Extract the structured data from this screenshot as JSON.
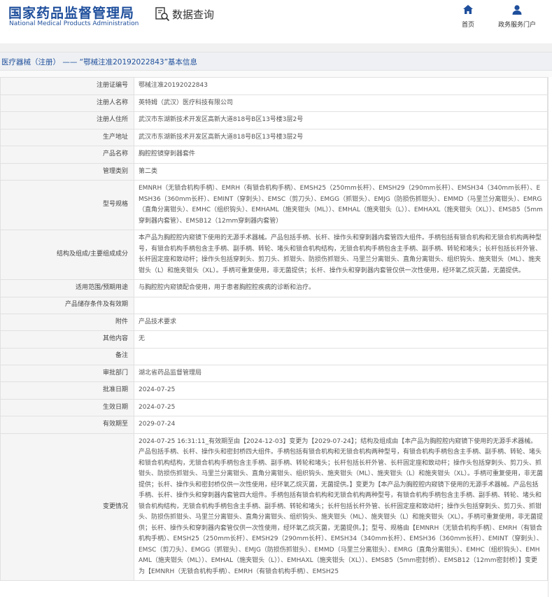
{
  "header": {
    "logo_cn": "国家药品监督管理局",
    "logo_en": "National Medical Products Administration",
    "data_query": "数据查询",
    "nav": {
      "home": "首页",
      "gov_service": "政务服务门户"
    }
  },
  "page_title": "医疗器械（注册） —— “鄂械注准20192022843”基本信息",
  "rows": [
    {
      "key": "注册证编号",
      "value": "鄂械注准20192022843"
    },
    {
      "key": "注册人名称",
      "value": "英特姆（武汉）医疗科技有限公司"
    },
    {
      "key": "注册人住所",
      "value": "武汉市东湖新技术开发区高新大道818号B区13号楼3层2号"
    },
    {
      "key": "生产地址",
      "value": "武汉市东湖新技术开发区高新大道818号B区13号楼3层2号"
    },
    {
      "key": "产品名称",
      "value": "胸腔腔镜穿刺器套件"
    },
    {
      "key": "管理类别",
      "value": "第二类"
    },
    {
      "key": "型号规格",
      "value": "EMNRH（无锁合机构手柄）、EMRH（有锁合机构手柄）、EMSH25（250mm长杆）、EMSH29（290mm长杆）、EMSH34（340mm长杆）、EMSH36（360mm长杆）、EMINT（穿刺头）、EMSC（剪刀头）、EMGG（抓钳头）、EMJG（防损伤抓钳头）、EMMD（马里兰分离钳头）、EMRG（直角分离钳头）、EMHC（组织钩头）、EMHAML（施夹钳头（ML））、EMHAL（施夹钳头（L））、EMHAXL（施夹钳头（XL））、EMSB5（5mm穿刺器内套管）、EMSB12（12mm穿刺器内套管）"
    },
    {
      "key": "结构及组成/主要组成成分",
      "value": "本产品为胸腔腔内窥镜下使用的无源手术器械。产品包括手柄、长杆、操作头和穿刺器内套管四大组件。手柄包括有锁合机构和无锁合机构两种型号，有锁合机构手柄包含主手柄、副手柄、转轮、堵头和锁合机构结构，无锁合机构手柄包含主手柄、副手柄、转轮和堵头；长杆包括长杆外管、长杆固定座和致动杆；操作头包括穿刺头、剪刀头、抓钳头、防损伤抓钳头、马里兰分离钳头、直角分离钳头、组织钩头、施夹钳头（ML）、施夹钳头（L）和施夹钳头（XL）。手柄可重复使用，非无菌提供；长杆、操作头和穿刺器内套管仅供一次性使用，经环氧乙烷灭菌，无菌提供。"
    },
    {
      "key": "适用范围/预期用途",
      "value": "与胸腔腔内窥镜配合使用，用于患者胸腔腔疾病的诊断和治疗。"
    },
    {
      "key": "产品储存条件及有效期",
      "value": ""
    },
    {
      "key": "附件",
      "value": "产品技术要求"
    },
    {
      "key": "其他内容",
      "value": "无"
    },
    {
      "key": "备注",
      "value": ""
    },
    {
      "key": "审批部门",
      "value": "湖北省药品监督管理局"
    },
    {
      "key": "批准日期",
      "value": "2024-07-25"
    },
    {
      "key": "生效日期",
      "value": "2024-07-25"
    },
    {
      "key": "有效期至",
      "value": "2029-07-24"
    },
    {
      "key": "变更情况",
      "value": "2024-07-25 16:31:11_有效期至由【2024-12-03】变更为【2029-07-24】；结构及组成由【本产品为胸腔腔内窥镜下使用的无源手术器械。产品包括手柄、长杆、操作头和密封桥四大组件。手柄包括有锁合机构和无锁合机构两种型号，有锁合机构手柄包含主手柄、副手柄、转轮、堵头和锁合机构结构，无锁合机构手柄包含主手柄、副手柄、转轮和堵头；长杆包括长杆外管、长杆固定座和致动杆；操作头包括穿刺头、剪刀头、抓钳头、防损伤抓钳头、马里兰分离钳头、直角分离钳头、组织钩头、施夹钳头（ML）、施夹钳头（L）和施夹钳头（XL）。手柄可重复使用，非无菌提供；长杆、操作头和密封桥仅供一次性使用，经环氧乙烷灭菌，无菌提供。】变更为【本产品为胸腔腔内窥镜下使用的无源手术器械。产品包括手柄、长杆、操作头和穿刺器内套管四大组件。手柄包括有锁合机构和无锁合机构两种型号，有锁合机构手柄包含主手柄、副手柄、转轮、堵头和锁合机构结构，无锁合机构手柄包含主手柄、副手柄、转轮和堵头；长杆包括长杆外管、长杆固定座和致动杆；操作头包括穿刺头、剪刀头、抓钳头、防损伤抓钳头、马里兰分离钳头、直角分离钳头、组织钩头、施夹钳头（ML）、施夹钳头（L）和施夹钳头（XL）。手柄可重复使用，非无菌提供；长杆、操作头和穿刺器内套管仅供一次性使用，经环氧乙烷灭菌，无菌提供。】；型号、规格由【EMNRH（无锁合机构手柄）、EMRH（有锁合机构手柄）、EMSH25（250mm长杆）、EMSH29（290mm长杆）、EMSH34（340mm长杆）、EMSH36（360mm长杆）、EMINT（穿刺头）、EMSC（剪刀头）、EMGG（抓钳头）、EMJG（防损伤抓钳头）、EMMD（马里兰分离钳头）、EMRG（直角分离钳头）、EMHC（组织钩头）、EMHAML（施夹钳头（ML））、EMHAL（施夹钳头（L））、EMHAXL（施夹钳头（XL））、EMSB5（5mm密封桥）、EMSB12（12mm密封桥）】变更为【EMNRH（无锁合机构手柄）、EMRH（有锁合机构手柄）、EMSH25"
    }
  ]
}
